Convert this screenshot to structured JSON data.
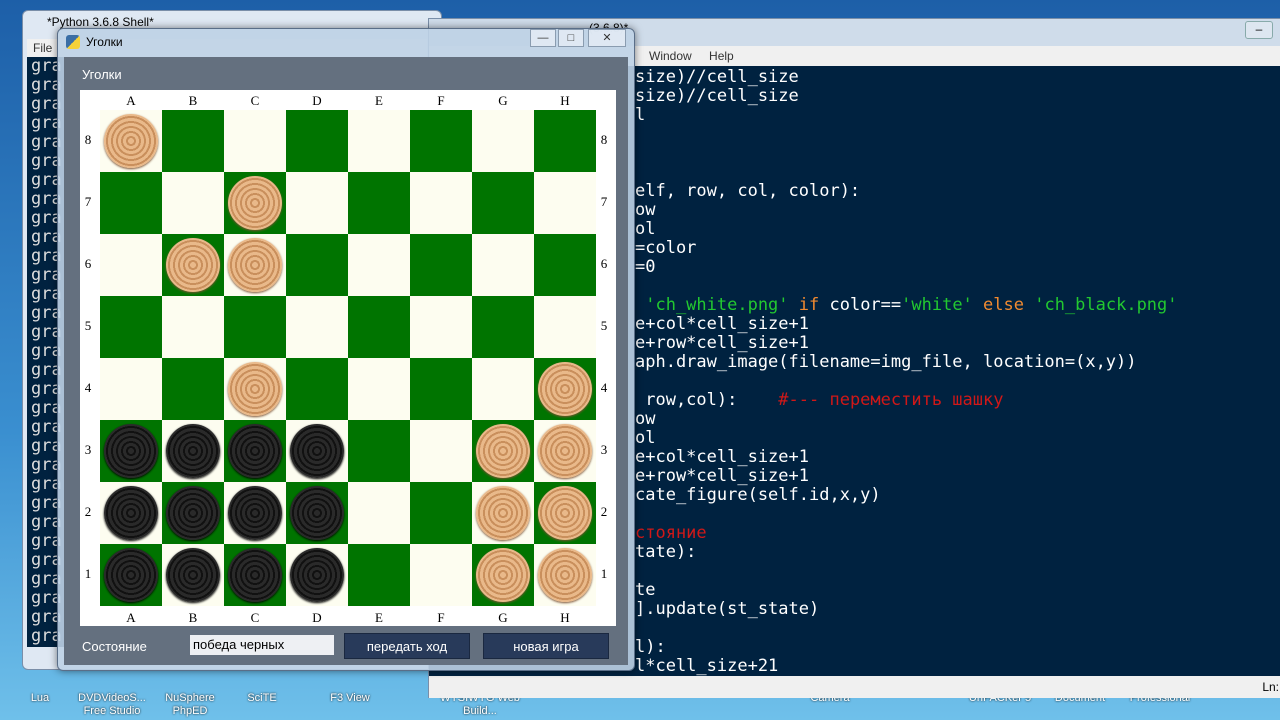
{
  "desktop": {
    "icons": [
      "Lua",
      "DVDVideoS... Free Studio",
      "NuSphere PhpED",
      "SciTE",
      "F3 View",
      "WYSIWYG Web Build...",
      "Camera",
      "UnPACKer 5",
      "Document",
      "Professional"
    ]
  },
  "shell": {
    "title": "*Python 3.6.8 Shell*",
    "menu": "File",
    "output_line": "gra"
  },
  "editor": {
    "title": "(3.6.8)*",
    "menu": [
      "Window",
      "Help"
    ],
    "status": "Ln:",
    "lines": [
      [
        [
          "size)//cell_size",
          "#ffffff"
        ]
      ],
      [
        [
          "size)//cell_size",
          "#ffffff"
        ]
      ],
      [
        [
          "l",
          "#ffffff"
        ]
      ],
      [],
      [],
      [],
      [
        [
          "elf, row, col, color):",
          "#ffffff"
        ]
      ],
      [
        [
          "ow",
          "#ffffff"
        ]
      ],
      [
        [
          "ol",
          "#ffffff"
        ]
      ],
      [
        [
          "=color",
          "#ffffff"
        ]
      ],
      [
        [
          "=0",
          "#ffffff"
        ]
      ],
      [],
      [
        [
          " 'ch_white.png'",
          "#22c830"
        ],
        [
          " if ",
          "#f08a30"
        ],
        [
          "color==",
          "#ffffff"
        ],
        [
          "'white'",
          "#22c830"
        ],
        [
          " else ",
          "#f08a30"
        ],
        [
          "'ch_black.png'",
          "#22c830"
        ]
      ],
      [
        [
          "e+col*cell_size+1",
          "#ffffff"
        ]
      ],
      [
        [
          "e+row*cell_size+1",
          "#ffffff"
        ]
      ],
      [
        [
          "aph.draw_image(filename=img_file, location=(x,y))",
          "#ffffff"
        ]
      ],
      [],
      [
        [
          " row,col):    ",
          "#ffffff"
        ],
        [
          "#--- переместить шашку",
          "#d01818"
        ]
      ],
      [
        [
          "ow",
          "#ffffff"
        ]
      ],
      [
        [
          "ol",
          "#ffffff"
        ]
      ],
      [
        [
          "e+col*cell_size+1",
          "#ffffff"
        ]
      ],
      [
        [
          "e+row*cell_size+1",
          "#ffffff"
        ]
      ],
      [
        [
          "cate_figure(self.id,x,y)",
          "#ffffff"
        ]
      ],
      [],
      [
        [
          "стояние",
          "#d01818"
        ]
      ],
      [
        [
          "tate):",
          "#ffffff"
        ]
      ],
      [],
      [
        [
          "te",
          "#ffffff"
        ]
      ],
      [
        [
          "].update(st_state)",
          "#ffffff"
        ]
      ],
      [],
      [
        [
          "l):",
          "#ffffff"
        ]
      ],
      [
        [
          "l*cell_size+21",
          "#ffffff"
        ]
      ]
    ]
  },
  "dialog": {
    "title": "Уголки",
    "heading": "Уголки",
    "columns": [
      "A",
      "B",
      "C",
      "D",
      "E",
      "F",
      "G",
      "H"
    ],
    "rows": [
      "8",
      "7",
      "6",
      "5",
      "4",
      "3",
      "2",
      "1"
    ],
    "board": [
      "w.......",
      "..w.....",
      ".ww.....",
      "........",
      "..w....w",
      "bbbb..ww",
      "bbbb..ww",
      "bbbb..ww"
    ],
    "colors": {
      "dark": "#007400",
      "light": "#fdfdf0"
    },
    "state_label": "Состояние",
    "state_value": "победа черных",
    "pass_button": "передать ход",
    "new_game_button": "новая игра"
  }
}
